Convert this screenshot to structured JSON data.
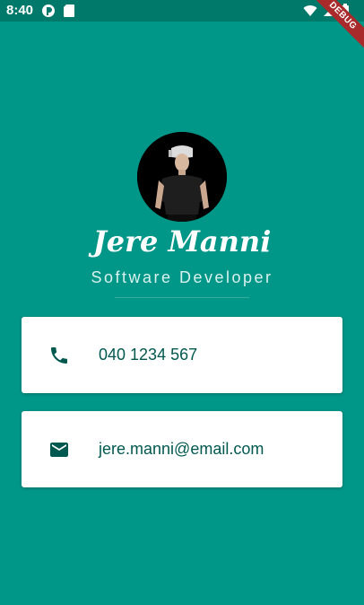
{
  "status_bar": {
    "time": "8:40"
  },
  "debug_banner": "DEBUG",
  "profile": {
    "name": "Jere Manni",
    "title": "Software Developer"
  },
  "contacts": {
    "phone": {
      "icon": "phone-icon",
      "value": "040 1234 567"
    },
    "email": {
      "icon": "mail-icon",
      "value": "jere.manni@email.com"
    }
  },
  "colors": {
    "background": "#009688",
    "status_bar": "#00796b",
    "card": "#ffffff",
    "card_text": "#00584f",
    "debug_ribbon": "#a82a2a"
  }
}
